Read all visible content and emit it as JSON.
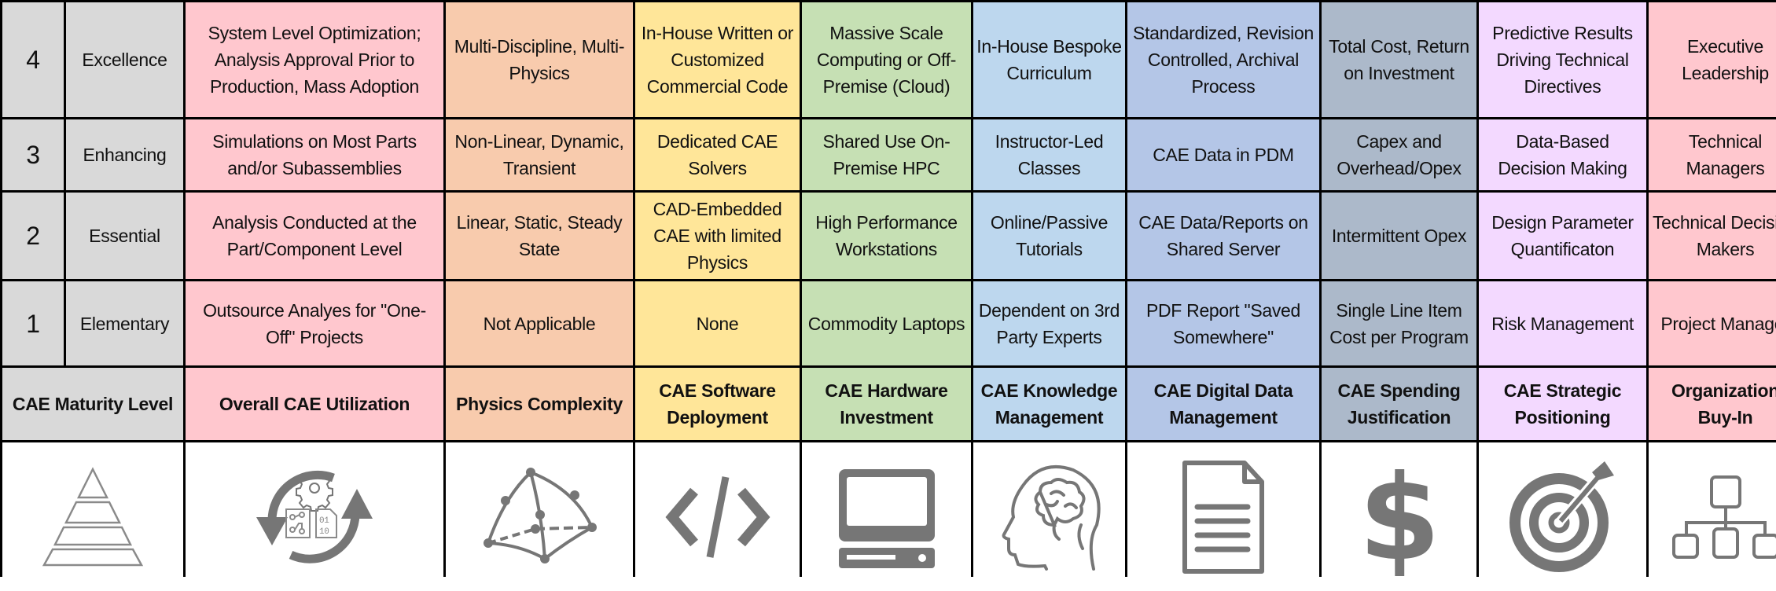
{
  "levels": [
    {
      "number": "4",
      "name": "Excellence"
    },
    {
      "number": "3",
      "name": "Enhancing"
    },
    {
      "number": "2",
      "name": "Essential"
    },
    {
      "number": "1",
      "name": "Elementary"
    }
  ],
  "categories": [
    {
      "key": "overall-cae-utilization",
      "header": "Overall CAE Utilization",
      "color": "#ffc7ce",
      "icon": "cycle-gear-circuit-binary-icon",
      "levels": {
        "4": "System Level Optimization; Analysis Approval Prior to Production, Mass Adoption",
        "3": "Simulations on Most Parts and/or Subassemblies",
        "2": "Analysis Conducted at the Part/Component Level",
        "1": "Outsource Analyes for \"One-Off\" Projects"
      }
    },
    {
      "key": "physics-complexity",
      "header": "Physics Complexity",
      "color": "#f8cbad",
      "icon": "mesh-element-icon",
      "levels": {
        "4": "Multi-Discipline, Multi-Physics",
        "3": "Non-Linear, Dynamic, Transient",
        "2": "Linear, Static, Steady State",
        "1": "Not Applicable"
      }
    },
    {
      "key": "cae-software-deployment",
      "header": "CAE Software Deployment",
      "color": "#ffe699",
      "icon": "code-icon",
      "levels": {
        "4": "In-House Written or Customized Commercial Code",
        "3": "Dedicated CAE Solvers",
        "2": "CAD-Embedded CAE with limited Physics",
        "1": "None"
      }
    },
    {
      "key": "cae-hardware-investment",
      "header": "CAE Hardware Investment",
      "color": "#c6e0b4",
      "icon": "computer-icon",
      "levels": {
        "4": "Massive Scale Computing or Off-Premise (Cloud)",
        "3": "Shared Use On-Premise HPC",
        "2": "High Performance Workstations",
        "1": "Commodity Laptops"
      }
    },
    {
      "key": "cae-knowledge-management",
      "header": "CAE Knowledge Management",
      "color": "#bdd7ee",
      "icon": "brain-head-icon",
      "levels": {
        "4": "In-House Bespoke Curriculum",
        "3": "Instructor-Led Classes",
        "2": "Online/Passive Tutorials",
        "1": "Dependent on 3rd Party Experts"
      }
    },
    {
      "key": "cae-digital-data-management",
      "header": "CAE Digital Data Management",
      "color": "#b4c6e7",
      "icon": "document-icon",
      "levels": {
        "4": "Standardized, Revision Controlled, Archival Process",
        "3": "CAE Data in PDM",
        "2": "CAE Data/Reports on Shared Server",
        "1": "PDF Report \"Saved Somewhere\""
      }
    },
    {
      "key": "cae-spending-justification",
      "header": "CAE Spending Justification",
      "color": "#acb9ca",
      "icon": "dollar-icon",
      "levels": {
        "4": "Total Cost, Return on Investment",
        "3": "Capex and Overhead/Opex",
        "2": "Intermittent Opex",
        "1": "Single Line Item Cost per Program"
      }
    },
    {
      "key": "cae-strategic-positioning",
      "header": "CAE Strategic Positioning",
      "color": "#f3d9ff",
      "icon": "target-icon",
      "levels": {
        "4": "Predictive Results Driving Technical Directives",
        "3": "Data-Based Decision Making",
        "2": "Design Parameter Quantificaton",
        "1": "Risk Management"
      }
    },
    {
      "key": "organization-buy-in",
      "header": "Organization Buy-In",
      "color": "#ffc7ce",
      "icon": "org-chart-icon",
      "levels": {
        "4": "Executive Leadership",
        "3": "Technical Managers",
        "2": "Technical Decision Makers",
        "1": "Project Manager"
      }
    }
  ],
  "maturity_header": "CAE Maturity Level",
  "maturity_icon": "pyramid-icon",
  "icon_color": "#767676",
  "binary_digits": [
    "01",
    "10"
  ]
}
